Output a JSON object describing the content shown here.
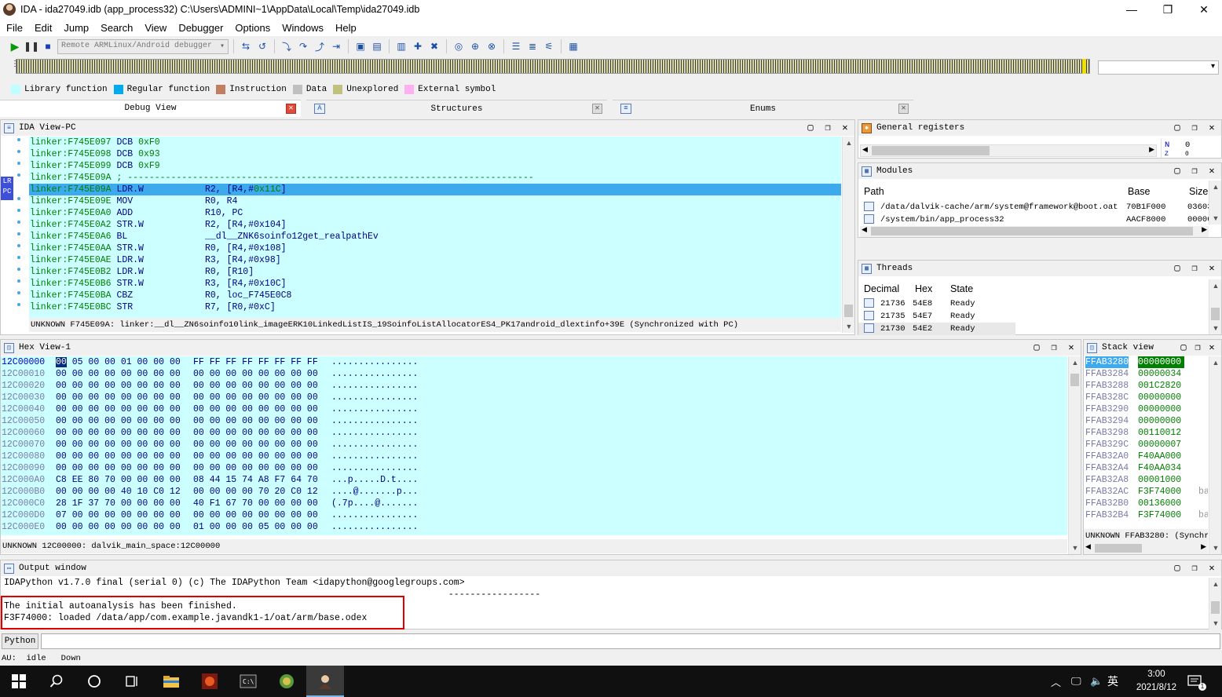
{
  "window": {
    "title": "IDA - ida27049.idb (app_process32) C:\\Users\\ADMINI~1\\AppData\\Local\\Temp\\ida27049.idb",
    "minimize": "—",
    "maximize": "❐",
    "close": "✕"
  },
  "menu": [
    "File",
    "Edit",
    "Jump",
    "Search",
    "View",
    "Debugger",
    "Options",
    "Windows",
    "Help"
  ],
  "toolbar": {
    "debugger_select": "Remote ARMLinux/Android debugger"
  },
  "legend": [
    {
      "label": "Library function",
      "color": "#bfffff"
    },
    {
      "label": "Regular function",
      "color": "#00aaee"
    },
    {
      "label": "Instruction",
      "color": "#c08060"
    },
    {
      "label": "Data",
      "color": "#c0c0c0"
    },
    {
      "label": "Unexplored",
      "color": "#c0c080"
    },
    {
      "label": "External symbol",
      "color": "#ffb0f0"
    }
  ],
  "tabs": [
    {
      "label": "Debug View",
      "close": "✕"
    },
    {
      "label": "Structures",
      "close": "✕"
    },
    {
      "label": "Enums",
      "close": "✕"
    }
  ],
  "ida_view": {
    "title": "IDA View-PC",
    "lr_pc": [
      "LR",
      "PC"
    ],
    "lines": [
      {
        "addr": "linker:F745E097",
        "mn": "DCB",
        "ops": "",
        "num": "0xF0"
      },
      {
        "addr": "linker:F745E098",
        "mn": "DCB",
        "ops": "",
        "num": "0x93"
      },
      {
        "addr": "linker:F745E099",
        "mn": "DCB",
        "ops": "",
        "num": "0xF9"
      },
      {
        "addr": "linker:F745E09A",
        "mn": "; ---------------------------------------------------------------------------",
        "ops": "",
        "num": ""
      },
      {
        "addr": "linker:F745E09A",
        "mn": "LDR.W",
        "ops": "R2, [R4,#",
        "num": "0x11C",
        "tail": "]"
      },
      {
        "addr": "linker:F745E09E",
        "mn": "MOV",
        "ops": "R0, R4",
        "num": ""
      },
      {
        "addr": "linker:F745E0A0",
        "mn": "ADD",
        "ops": "R10, PC",
        "num": ""
      },
      {
        "addr": "linker:F745E0A2",
        "mn": "STR.W",
        "ops": "R2, [R4,#0x104]",
        "num": ""
      },
      {
        "addr": "linker:F745E0A6",
        "mn": "BL",
        "ops": "__dl__ZNK6soinfo12get_realpathEv",
        "num": ""
      },
      {
        "addr": "linker:F745E0AA",
        "mn": "STR.W",
        "ops": "R0, [R4,#0x108]",
        "num": ""
      },
      {
        "addr": "linker:F745E0AE",
        "mn": "LDR.W",
        "ops": "R3, [R4,#0x98]",
        "num": ""
      },
      {
        "addr": "linker:F745E0B2",
        "mn": "LDR.W",
        "ops": "R0, [R10]",
        "num": ""
      },
      {
        "addr": "linker:F745E0B6",
        "mn": "STR.W",
        "ops": "R3, [R4,#0x10C]",
        "num": ""
      },
      {
        "addr": "linker:F745E0BA",
        "mn": "CBZ",
        "ops": "R0, loc_F745E0C8",
        "num": ""
      },
      {
        "addr": "linker:F745E0BC",
        "mn": "STR",
        "ops": "R7, [R0,#0xC]",
        "num": ""
      }
    ],
    "status": "UNKNOWN F745E09A: linker:__dl__ZN6soinfo10link_imageERK10LinkedListIS_19SoinfoListAllocatorES4_PK17android_dlextinfo+39E (Synchronized with PC)"
  },
  "general_registers": {
    "title": "General registers",
    "flag": "N",
    "flag_value": "0",
    "flag2": "Z",
    "flag2_value": "0"
  },
  "modules": {
    "title": "Modules",
    "columns": [
      "Path",
      "Base",
      "Size"
    ],
    "rows": [
      {
        "path": "/data/dalvik-cache/arm/system@framework@boot.oat",
        "base": "70B1F000",
        "size": "03603"
      },
      {
        "path": "/system/bin/app_process32",
        "base": "AACF8000",
        "size": "00000"
      }
    ]
  },
  "threads": {
    "title": "Threads",
    "columns": [
      "Decimal",
      "Hex",
      "State"
    ],
    "rows": [
      {
        "decimal": "21736",
        "hex": "54E8",
        "state": "Ready"
      },
      {
        "decimal": "21735",
        "hex": "54E7",
        "state": "Ready"
      },
      {
        "decimal": "21730",
        "hex": "54E2",
        "state": "Ready"
      }
    ]
  },
  "hex_view": {
    "title": "Hex View-1",
    "selected_byte": "00",
    "rows": [
      {
        "addr": "12C00000",
        "b1": "05 00 00 01 00 00 00",
        "b2": "FF FF FF FF FF FF FF FF",
        "chars": "................"
      },
      {
        "addr": "12C00010",
        "b1": "00 00 00 00 00 00 00 00",
        "b2": "00 00 00 00 00 00 00 00",
        "chars": "................"
      },
      {
        "addr": "12C00020",
        "b1": "00 00 00 00 00 00 00 00",
        "b2": "00 00 00 00 00 00 00 00",
        "chars": "................"
      },
      {
        "addr": "12C00030",
        "b1": "00 00 00 00 00 00 00 00",
        "b2": "00 00 00 00 00 00 00 00",
        "chars": "................"
      },
      {
        "addr": "12C00040",
        "b1": "00 00 00 00 00 00 00 00",
        "b2": "00 00 00 00 00 00 00 00",
        "chars": "................"
      },
      {
        "addr": "12C00050",
        "b1": "00 00 00 00 00 00 00 00",
        "b2": "00 00 00 00 00 00 00 00",
        "chars": "................"
      },
      {
        "addr": "12C00060",
        "b1": "00 00 00 00 00 00 00 00",
        "b2": "00 00 00 00 00 00 00 00",
        "chars": "................"
      },
      {
        "addr": "12C00070",
        "b1": "00 00 00 00 00 00 00 00",
        "b2": "00 00 00 00 00 00 00 00",
        "chars": "................"
      },
      {
        "addr": "12C00080",
        "b1": "00 00 00 00 00 00 00 00",
        "b2": "00 00 00 00 00 00 00 00",
        "chars": "................"
      },
      {
        "addr": "12C00090",
        "b1": "00 00 00 00 00 00 00 00",
        "b2": "00 00 00 00 00 00 00 00",
        "chars": "................"
      },
      {
        "addr": "12C000A0",
        "b1": "C8 EE 80 70 00 00 00 00",
        "b2": "08 44 15 74 A8 F7 64 70",
        "chars": "...p.....D.t...."
      },
      {
        "addr": "12C000B0",
        "b1": "00 00 00 00 40 10 C0 12",
        "b2": "00 00 00 00 70 20 C0 12",
        "chars": "....@.......p..."
      },
      {
        "addr": "12C000C0",
        "b1": "28 1F 37 70 00 00 00 00",
        "b2": "40 F1 67 70 00 00 00 00",
        "chars": "(.7p....@......."
      },
      {
        "addr": "12C000D0",
        "b1": "07 00 00 00 00 00 00 00",
        "b2": "00 00 00 00 00 00 00 00",
        "chars": "................"
      },
      {
        "addr": "12C000E0",
        "b1": "00 00 00 00 00 00 00 00",
        "b2": "01 00 00 00 05 00 00 00",
        "chars": "................"
      }
    ],
    "status": "UNKNOWN 12C00000: dalvik_main_space:12C00000"
  },
  "stack_view": {
    "title": "Stack view",
    "rows": [
      {
        "addr": "FFAB3280",
        "val": "00000000",
        "c": ""
      },
      {
        "addr": "FFAB3284",
        "val": "00000034",
        "c": ""
      },
      {
        "addr": "FFAB3288",
        "val": "001C2820",
        "c": ""
      },
      {
        "addr": "FFAB328C",
        "val": "00000000",
        "c": ""
      },
      {
        "addr": "FFAB3290",
        "val": "00000000",
        "c": ""
      },
      {
        "addr": "FFAB3294",
        "val": "00000000",
        "c": ""
      },
      {
        "addr": "FFAB3298",
        "val": "00110012",
        "c": ""
      },
      {
        "addr": "FFAB329C",
        "val": "00000007",
        "c": ""
      },
      {
        "addr": "FFAB32A0",
        "val": "F40AA000",
        "c": ""
      },
      {
        "addr": "FFAB32A4",
        "val": "F40AA034",
        "c": ""
      },
      {
        "addr": "FFAB32A8",
        "val": "00001000",
        "c": ""
      },
      {
        "addr": "FFAB32AC",
        "val": "F3F74000",
        "c": "bas"
      },
      {
        "addr": "FFAB32B0",
        "val": "00136000",
        "c": ""
      },
      {
        "addr": "FFAB32B4",
        "val": "F3F74000",
        "c": "bas"
      }
    ],
    "status": "UNKNOWN FFAB3280: (Synchron"
  },
  "output": {
    "title": "Output window",
    "lines": [
      "IDAPython v1.7.0 final (serial 0) (c) The IDAPython Team <idapython@googlegroups.com>",
      "                                                                                  -----------------",
      "The initial autoanalysis has been finished.",
      "F3F74000: loaded /data/app/com.example.javandk1-1/oat/arm/base.odex"
    ]
  },
  "python": {
    "button": "Python"
  },
  "statusbar": "AU:  idle   Down",
  "taskbar": {
    "tray_ime": "英",
    "time": "3:00",
    "date": "2021/8/12",
    "notif_count": "1"
  }
}
